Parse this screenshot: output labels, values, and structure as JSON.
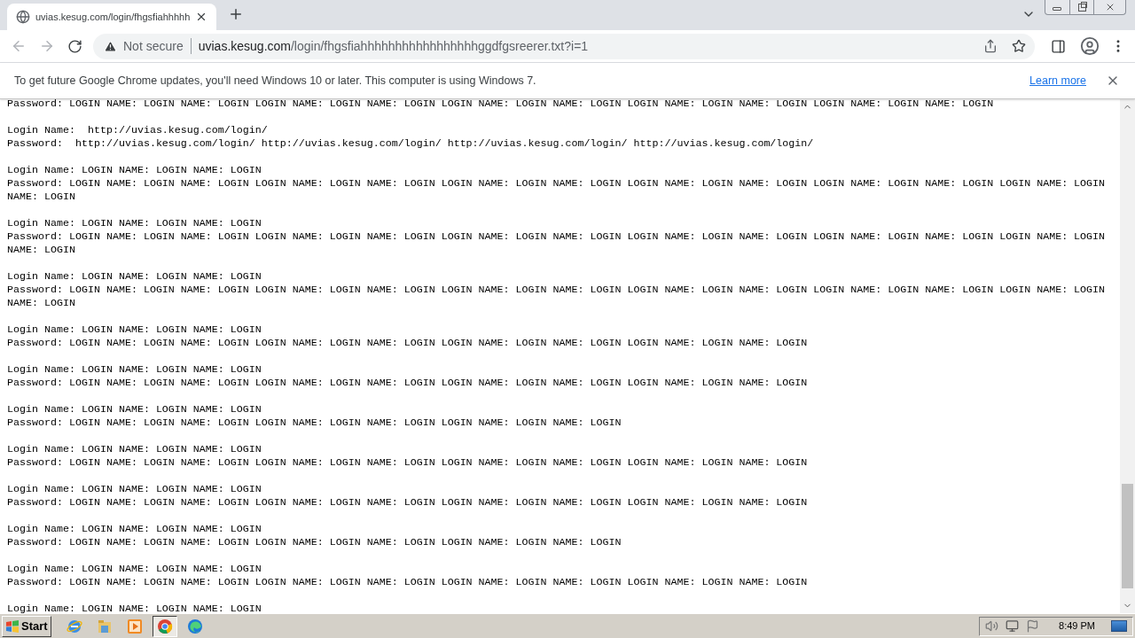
{
  "tab": {
    "title": "uvias.kesug.com/login/fhgsfiahhhhh",
    "selected": true
  },
  "address_bar": {
    "security": "Not secure",
    "host": "uvias.kesug.com",
    "path": "/login/fhgsfiahhhhhhhhhhhhhhhhhggdfgsreerer.txt?i=1"
  },
  "infobar": {
    "message": "To get future Google Chrome updates, you'll need Windows 10 or later. This computer is using Windows 7.",
    "link": "Learn more"
  },
  "records": [
    {
      "lines": [
        "Password: LOGIN NAME: LOGIN NAME: LOGIN LOGIN NAME: LOGIN NAME: LOGIN LOGIN NAME: LOGIN NAME: LOGIN LOGIN NAME: LOGIN NAME: LOGIN LOGIN NAME: LOGIN NAME: LOGIN"
      ]
    },
    {
      "lines": [
        "Login Name:  http://uvias.kesug.com/login/",
        "Password:  http://uvias.kesug.com/login/ http://uvias.kesug.com/login/ http://uvias.kesug.com/login/ http://uvias.kesug.com/login/"
      ]
    },
    {
      "lines": [
        "Login Name: LOGIN NAME: LOGIN NAME: LOGIN",
        "Password: LOGIN NAME: LOGIN NAME: LOGIN LOGIN NAME: LOGIN NAME: LOGIN LOGIN NAME: LOGIN NAME: LOGIN LOGIN NAME: LOGIN NAME: LOGIN LOGIN NAME: LOGIN NAME: LOGIN LOGIN NAME: LOGIN NAME: LOGIN"
      ]
    },
    {
      "lines": [
        "Login Name: LOGIN NAME: LOGIN NAME: LOGIN",
        "Password: LOGIN NAME: LOGIN NAME: LOGIN LOGIN NAME: LOGIN NAME: LOGIN LOGIN NAME: LOGIN NAME: LOGIN LOGIN NAME: LOGIN NAME: LOGIN LOGIN NAME: LOGIN NAME: LOGIN LOGIN NAME: LOGIN NAME: LOGIN"
      ]
    },
    {
      "lines": [
        "Login Name: LOGIN NAME: LOGIN NAME: LOGIN",
        "Password: LOGIN NAME: LOGIN NAME: LOGIN LOGIN NAME: LOGIN NAME: LOGIN LOGIN NAME: LOGIN NAME: LOGIN LOGIN NAME: LOGIN NAME: LOGIN LOGIN NAME: LOGIN NAME: LOGIN LOGIN NAME: LOGIN NAME: LOGIN"
      ]
    },
    {
      "lines": [
        "Login Name: LOGIN NAME: LOGIN NAME: LOGIN",
        "Password: LOGIN NAME: LOGIN NAME: LOGIN LOGIN NAME: LOGIN NAME: LOGIN LOGIN NAME: LOGIN NAME: LOGIN LOGIN NAME: LOGIN NAME: LOGIN"
      ]
    },
    {
      "lines": [
        "Login Name: LOGIN NAME: LOGIN NAME: LOGIN",
        "Password: LOGIN NAME: LOGIN NAME: LOGIN LOGIN NAME: LOGIN NAME: LOGIN LOGIN NAME: LOGIN NAME: LOGIN LOGIN NAME: LOGIN NAME: LOGIN"
      ]
    },
    {
      "lines": [
        "Login Name: LOGIN NAME: LOGIN NAME: LOGIN",
        "Password: LOGIN NAME: LOGIN NAME: LOGIN LOGIN NAME: LOGIN NAME: LOGIN LOGIN NAME: LOGIN NAME: LOGIN"
      ]
    },
    {
      "lines": [
        "Login Name: LOGIN NAME: LOGIN NAME: LOGIN",
        "Password: LOGIN NAME: LOGIN NAME: LOGIN LOGIN NAME: LOGIN NAME: LOGIN LOGIN NAME: LOGIN NAME: LOGIN LOGIN NAME: LOGIN NAME: LOGIN"
      ]
    },
    {
      "lines": [
        "Login Name: LOGIN NAME: LOGIN NAME: LOGIN",
        "Password: LOGIN NAME: LOGIN NAME: LOGIN LOGIN NAME: LOGIN NAME: LOGIN LOGIN NAME: LOGIN NAME: LOGIN LOGIN NAME: LOGIN NAME: LOGIN"
      ]
    },
    {
      "lines": [
        "Login Name: LOGIN NAME: LOGIN NAME: LOGIN",
        "Password: LOGIN NAME: LOGIN NAME: LOGIN LOGIN NAME: LOGIN NAME: LOGIN LOGIN NAME: LOGIN NAME: LOGIN"
      ]
    },
    {
      "lines": [
        "Login Name: LOGIN NAME: LOGIN NAME: LOGIN",
        "Password: LOGIN NAME: LOGIN NAME: LOGIN LOGIN NAME: LOGIN NAME: LOGIN LOGIN NAME: LOGIN NAME: LOGIN LOGIN NAME: LOGIN NAME: LOGIN"
      ]
    },
    {
      "lines": [
        "Login Name: LOGIN NAME: LOGIN NAME: LOGIN"
      ]
    }
  ],
  "taskbar": {
    "start": "Start",
    "apps": [
      {
        "kind": "ie",
        "selected": false
      },
      {
        "kind": "explorer",
        "selected": false
      },
      {
        "kind": "media",
        "selected": false
      },
      {
        "kind": "chrome",
        "selected": true
      },
      {
        "kind": "edge",
        "selected": false
      }
    ],
    "clock": "8:49 PM"
  }
}
